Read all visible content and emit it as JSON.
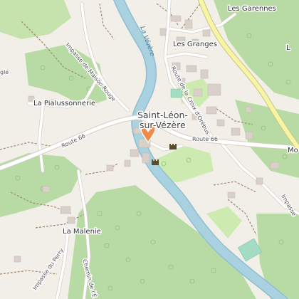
{
  "map": {
    "town": {
      "line1": "Saint-Léon-",
      "line2": "sur-Vézère"
    },
    "places": {
      "les_garennes": "Les Garennes",
      "les_granges": "Les Granges",
      "la_pialussonnerie": "La Pialussonnerie",
      "la_malenie": "La Malenie",
      "mo": "Mo"
    },
    "roads": {
      "route66_west": "Route 66",
      "route66_east": "Route 66",
      "impasse_maison_rouge": "Impasse de Maison Rouge",
      "route_croix_orebus": "Route de la Croix d'Orébus",
      "impasse_east": "Impasse",
      "impasse_perry": "Impasse du Perry",
      "chemin": "Chemin de l'Ê",
      "edge_left": "gle"
    },
    "river": {
      "name_north": "La Vézère"
    },
    "marker": {
      "icon": "location-pin-icon",
      "color": "#f08a4b"
    },
    "castle_icons": [
      "castle-icon",
      "castle-icon",
      "castle-icon"
    ],
    "colors": {
      "background": "#f2efe9",
      "forest": "#b8dba5",
      "grass": "#cdebb0",
      "water": "#a9d1df",
      "river_edge": "#8fbfd1",
      "road": "#ffffff",
      "road_casing": "#d5cec4",
      "main_road": "#f7f4a6",
      "main_road_casing": "#c9c481",
      "building": "#d9d0c9",
      "track": "#a1876a",
      "sport": "#a4dbc3"
    }
  }
}
